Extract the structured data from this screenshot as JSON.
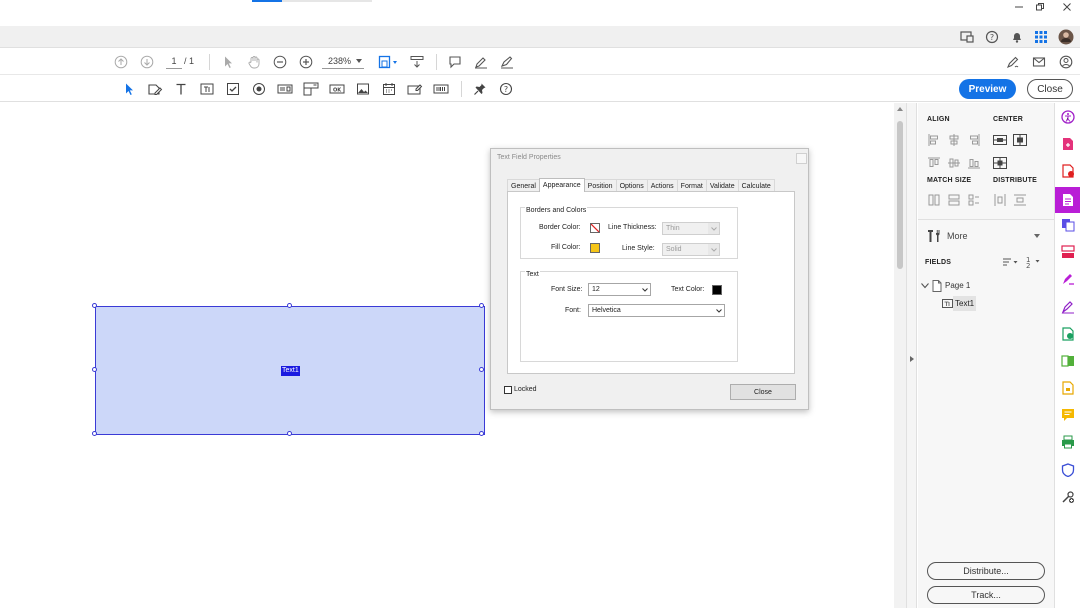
{
  "toolbar": {
    "page_current": "1",
    "page_total": "/ 1",
    "zoom": "238%",
    "preview_label": "Preview",
    "close_label": "Close"
  },
  "field": {
    "name": "Text1"
  },
  "dialog": {
    "title": "Text Field Properties",
    "tabs": [
      "General",
      "Appearance",
      "Position",
      "Options",
      "Actions",
      "Format",
      "Validate",
      "Calculate"
    ],
    "active_tab": "Appearance",
    "borders_colors_title": "Borders and Colors",
    "border_color_label": "Border Color:",
    "line_thickness_label": "Line Thickness:",
    "line_thickness_value": "Thin",
    "fill_color_label": "Fill Color:",
    "line_style_label": "Line Style:",
    "line_style_value": "Solid",
    "text_title": "Text",
    "font_size_label": "Font Size:",
    "font_size_value": "12",
    "text_color_label": "Text Color:",
    "font_label": "Font:",
    "font_value": "Helvetica",
    "locked_label": "Locked",
    "close_label": "Close",
    "colors": {
      "fill": "#f5c518",
      "text": "#000000"
    }
  },
  "panel": {
    "align_title": "ALIGN",
    "center_title": "CENTER",
    "match_size_title": "MATCH SIZE",
    "distribute_title": "DISTRIBUTE",
    "more_label": "More",
    "fields_title": "FIELDS",
    "tree_page": "Page 1",
    "tree_field": "Text1",
    "distribute_button": "Distribute...",
    "track_button": "Track..."
  },
  "theme": {
    "accent": "#1473e6",
    "field_fill": "#ccd7f9",
    "field_border": "#3a3ad6",
    "rail_active": "#b91ed6"
  }
}
